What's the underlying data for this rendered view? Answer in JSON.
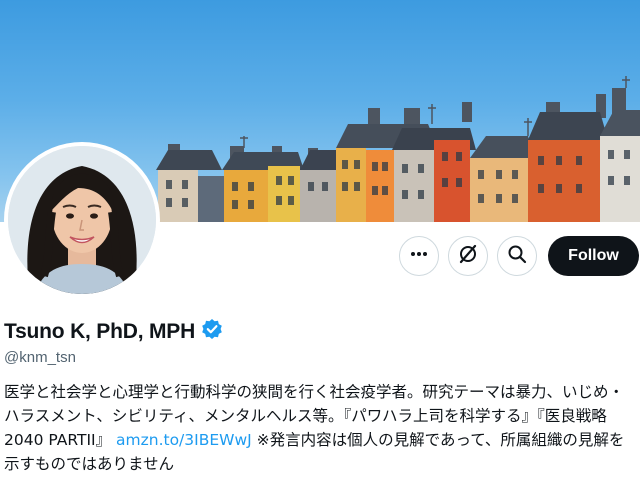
{
  "profile": {
    "display_name": "Tsuno K, PhD, MPH",
    "handle": "@knm_tsn",
    "verified": true,
    "bio": {
      "text_before_link": "医学と社会学と心理学と行動科学の狭間を行く社会疫学者。研究テーマは暴力、いじめ・ハラスメント、シビリティ、メンタルヘルス等。『パワハラ上司を科学する』『医良戦略2040 PARTII』 ",
      "link": "amzn.to/3IBEWwJ",
      "text_after_link": " ※発言内容は個人の見解であって、所属組織の見解を示すものではありません"
    }
  },
  "actions": {
    "more_icon": "more-horizontal-icon",
    "grok_icon": "grok-slash-icon",
    "search_icon": "search-icon",
    "follow_label": "Follow"
  },
  "colors": {
    "primary_text": "#0f1419",
    "secondary_text": "#536471",
    "link": "#1d9bf0",
    "verified_badge": "#1d9bf0",
    "follow_bg": "#0f1419"
  }
}
